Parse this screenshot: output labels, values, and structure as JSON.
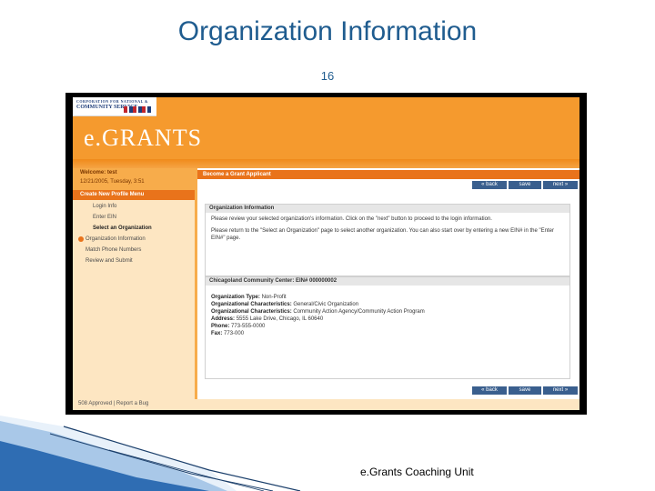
{
  "slide": {
    "title": "Organization Information",
    "number": "16",
    "caption": "e.Grants Coaching Unit"
  },
  "header": {
    "logo_line1": "CORPORATION FOR NATIONAL &",
    "logo_line2": "COMMUNITY SERVICE",
    "app_name": "e.GRANTS"
  },
  "sidebar": {
    "welcome": "Welcome: test",
    "date": "12/21/2005, Tuesday, 3:51",
    "menu_title": "Create New Profile Menu",
    "items": [
      {
        "label": "Login Info",
        "level": 2
      },
      {
        "label": "Enter EIN",
        "level": 2
      },
      {
        "label": "Select an Organization",
        "level": 2
      },
      {
        "label": "Organization Information",
        "level": 1,
        "current": true
      },
      {
        "label": "Match Phone Numbers",
        "level": 1
      },
      {
        "label": "Review and Submit",
        "level": 1
      }
    ]
  },
  "content": {
    "page_bar": "Become a Grant Applicant",
    "nav": {
      "back": "back",
      "save": "save",
      "next": "next"
    },
    "org_box_title": "Organization Information",
    "org_text_1": "Please review your selected organization's information. Click on the \"next\" button to proceed to the login information.",
    "org_text_2": "Please return to the \"Select an Organization\" page to select another organization. You can also start over by entering a new EIN# in the \"Enter EIN#\" page.",
    "detail_title": "Chicagoland Community Center: EIN# 000000002",
    "details": [
      {
        "label": "Organization Type:",
        "value": "Non-Profit"
      },
      {
        "label": "Organizational Characteristics:",
        "value": "General/Civic Organization"
      },
      {
        "label": "Organizational Characteristics:",
        "value": "Community Action Agency/Community Action Program"
      },
      {
        "label": "Address:",
        "value": "5555 Lake Drive, Chicago, IL 60640"
      },
      {
        "label": "Phone:",
        "value": "773-555-0000"
      },
      {
        "label": "Fax:",
        "value": "773-000"
      }
    ]
  },
  "footer": {
    "text": "508 Approved | Report a Bug"
  },
  "colors": {
    "title_blue": "#1f5c8f",
    "banner_orange": "#f59a2e",
    "menu_orange": "#e9731b",
    "button_blue": "#3a5f8e",
    "sidebar_bg": "#fde6c2"
  }
}
